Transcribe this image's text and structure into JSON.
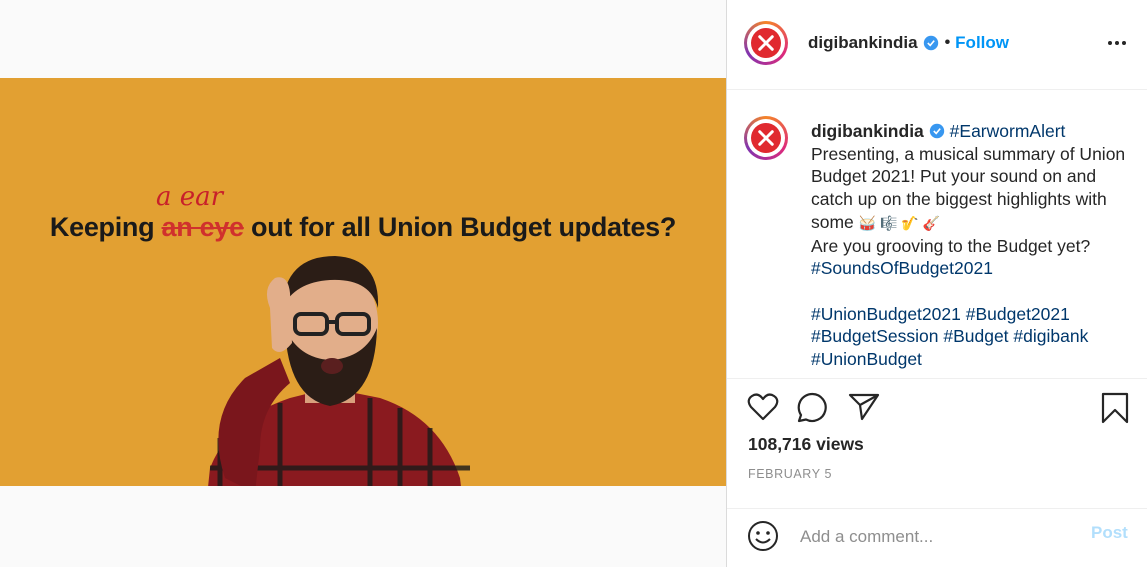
{
  "video": {
    "headline_before": "Keeping ",
    "headline_struck": "an eye",
    "headline_after": " out for all Union Budget updates?",
    "headline_insert": "a ear",
    "mute_icon": "speaker-muted-icon",
    "background_color": "#e2a032"
  },
  "header": {
    "username": "digibankindia",
    "separator": "•",
    "follow_label": "Follow",
    "more_icon": "more-options-icon"
  },
  "caption": {
    "username": "digibankindia",
    "tag_main": "#EarwormAlert",
    "line1": "Presenting, a musical summary of Union Budget 2021! Put your sound on and catch up on the biggest highlights with some ",
    "emojis": "🥁 🎼 🎷 🎸",
    "line2": "Are you grooving to the Budget yet?",
    "tag_sounds": "#SoundsOfBudget2021",
    "tags": [
      "#UnionBudget2021",
      "#Budget2021",
      "#BudgetSession",
      "#Budget",
      "#digibank",
      "#UnionBudget"
    ]
  },
  "actions": {
    "like_icon": "heart-icon",
    "comment_icon": "comment-icon",
    "share_icon": "share-icon",
    "save_icon": "bookmark-icon",
    "views": "108,716 views",
    "date": "FEBRUARY 5"
  },
  "comment": {
    "emoji_icon": "smiley-icon",
    "placeholder": "Add a comment...",
    "post_label": "Post"
  },
  "colors": {
    "accent": "#0095f6",
    "post_disabled": "#b2dffc",
    "hashtag": "#00376b",
    "brand_red": "#e0292f"
  }
}
